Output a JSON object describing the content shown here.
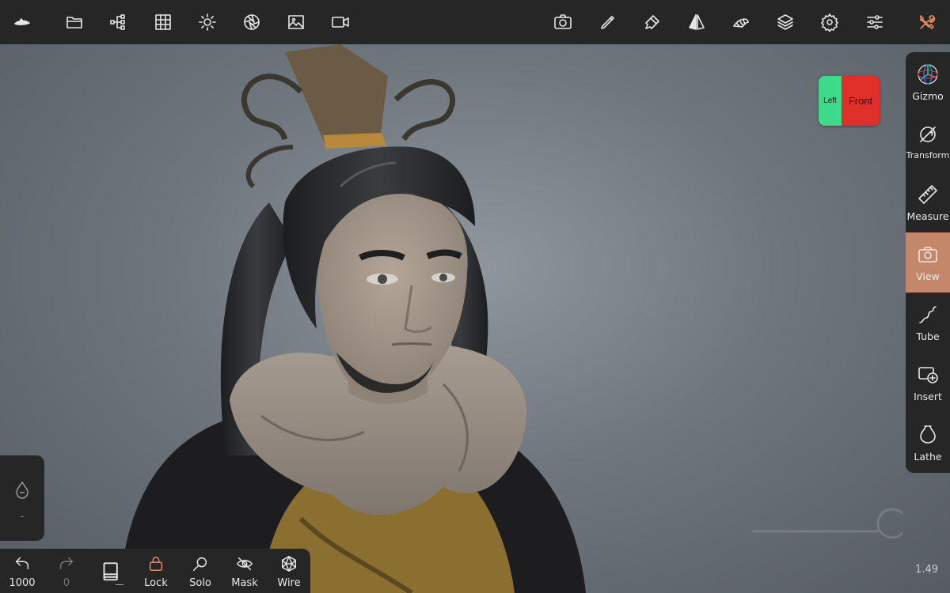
{
  "app": {
    "accent_color": "#c4876a",
    "panel_color": "#262626"
  },
  "top_toolbar": {
    "left_icons": [
      "logo-icon",
      "folder-icon",
      "scene-tree-icon",
      "grid-icon",
      "sun-icon",
      "aperture-icon",
      "image-icon",
      "video-icon"
    ],
    "right_icons": [
      "camera-icon",
      "brush-icon",
      "paint-brush-icon",
      "symmetry-icon",
      "topology-icon",
      "layers-icon",
      "settings-gear-icon",
      "sliders-icon",
      "tools-icon"
    ]
  },
  "view_cube": {
    "left_label": "Left",
    "front_label": "Front",
    "left_color": "#3fd98a",
    "front_color": "#e1302a"
  },
  "right_tools": [
    {
      "label": "Gizmo",
      "icon": "gizmo-icon",
      "active": false
    },
    {
      "label": "Transform",
      "icon": "transform-icon",
      "active": false
    },
    {
      "label": "Measure",
      "icon": "ruler-icon",
      "active": false
    },
    {
      "label": "View",
      "icon": "camera-icon",
      "active": true
    },
    {
      "label": "Tube",
      "icon": "tube-icon",
      "active": false
    },
    {
      "label": "Insert",
      "icon": "insert-icon",
      "active": false
    },
    {
      "label": "Lathe",
      "icon": "lathe-icon",
      "active": false
    }
  ],
  "left_panel": {
    "icon": "drop-icon",
    "value": "-"
  },
  "bottom_tools": {
    "undo_count": "1000",
    "redo_count": "0",
    "lock_label": "Lock",
    "solo_label": "Solo",
    "mask_label": "Mask",
    "wire_label": "Wire"
  },
  "version": "1.49"
}
